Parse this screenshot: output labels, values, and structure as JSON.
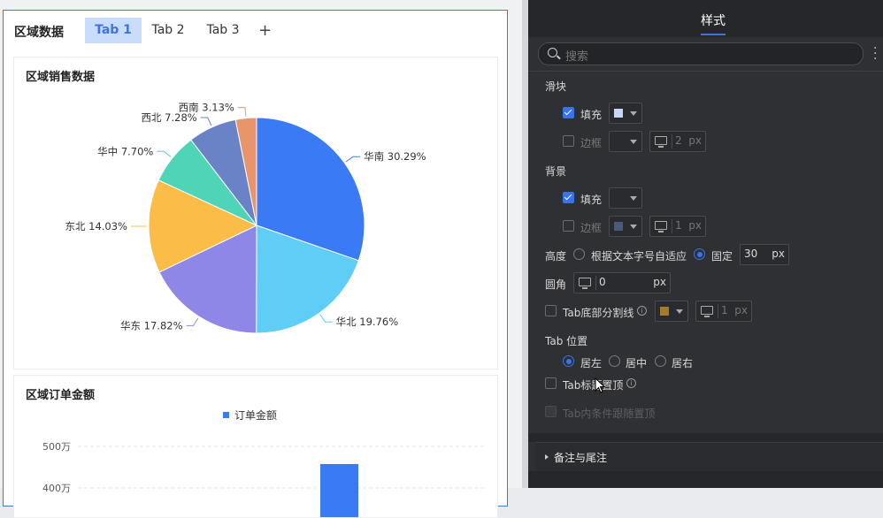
{
  "tabs": {
    "title": "区域数据",
    "items": [
      "Tab 1",
      "Tab 2",
      "Tab 3"
    ],
    "add": "+"
  },
  "pie_card": {
    "title": "区域销售数据"
  },
  "bar_card": {
    "title": "区域订单金额",
    "legend": "订单金额"
  },
  "chart_data": [
    {
      "type": "pie",
      "title": "区域销售数据",
      "labels": [
        "华南",
        "华北",
        "华东",
        "东北",
        "华中",
        "西北",
        "西南"
      ],
      "values": [
        30.29,
        19.76,
        17.82,
        14.03,
        7.7,
        7.28,
        3.13
      ],
      "display": [
        "华南 30.29%",
        "华北 19.76%",
        "华东 17.82%",
        "东北 14.03%",
        "华中 7.70%",
        "西北 7.28%",
        "西南 3.13%"
      ],
      "colors": [
        "#3a7bf5",
        "#5fcdf5",
        "#8e87e8",
        "#fbbd48",
        "#4fd4b8",
        "#6a82c6",
        "#e8956b"
      ]
    },
    {
      "type": "bar",
      "title": "区域订单金额",
      "series": [
        {
          "name": "订单金额",
          "color": "#3a7bf5"
        }
      ],
      "y_ticks": [
        "500万",
        "400万"
      ]
    }
  ],
  "panel": {
    "title": "样式",
    "search_placeholder": "搜索",
    "slider": {
      "section": "滑块",
      "fill": "填充",
      "border": "边框",
      "border_val": "2",
      "unit": "px",
      "fill_color": "#c7d7fb"
    },
    "background": {
      "section": "背景",
      "fill": "填充",
      "border": "边框",
      "border_val": "1",
      "unit": "px",
      "border_color": "#4d5a7a"
    },
    "height": {
      "label": "高度",
      "opt_auto": "根据文本字号自适应",
      "opt_fixed": "固定",
      "value": "30",
      "unit": "px"
    },
    "radius": {
      "label": "圆角",
      "value": "0",
      "unit": "px"
    },
    "divider": {
      "label": "Tab底部分割线",
      "value": "1",
      "unit": "px",
      "color": "#a67c2c"
    },
    "position": {
      "label": "Tab 位置",
      "left": "居左",
      "center": "居中",
      "right": "居右"
    },
    "sticky": "Tab标题置顶",
    "cond_sticky": "Tab内条件跟随置顶",
    "section2": "备注与尾注"
  }
}
